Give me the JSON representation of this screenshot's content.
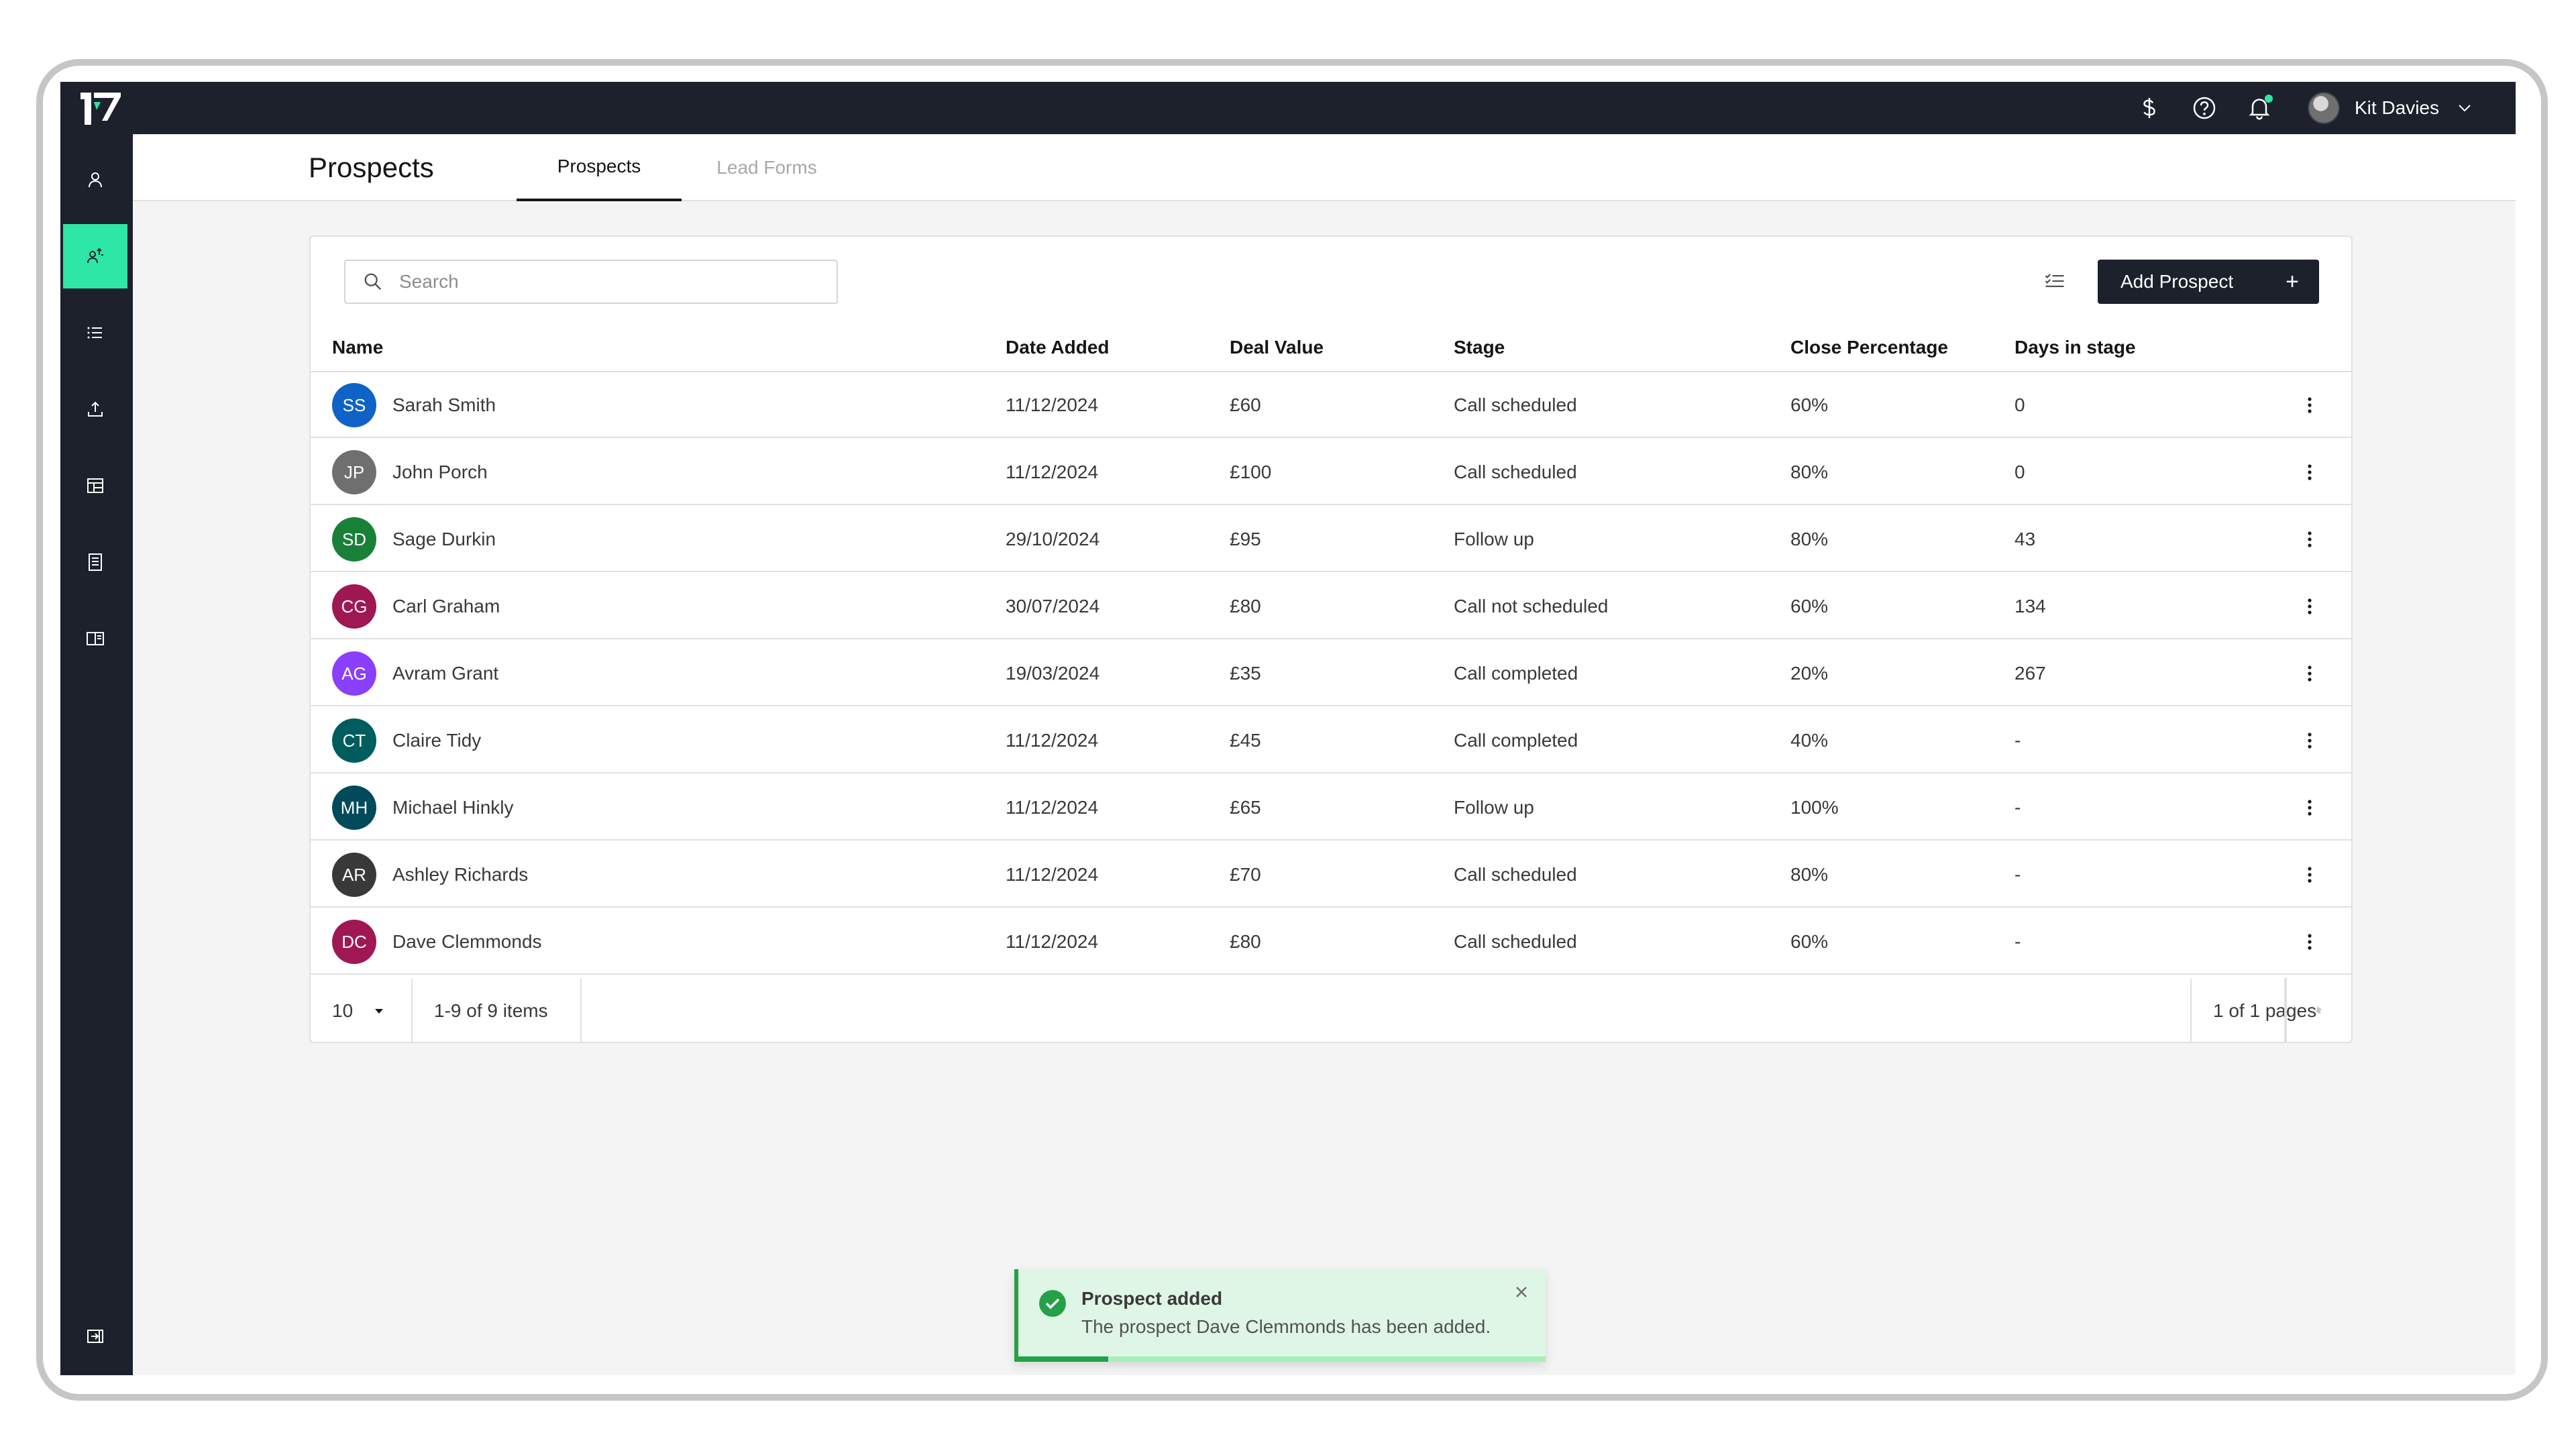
{
  "header": {
    "user_name": "Kit Davies",
    "icons": [
      "dollar-icon",
      "help-icon",
      "notification-bell-icon"
    ]
  },
  "sidebar": {
    "items": [
      {
        "icon": "user-icon",
        "active": false
      },
      {
        "icon": "prospects-icon",
        "active": true
      },
      {
        "icon": "list-icon",
        "active": false
      },
      {
        "icon": "upload-icon",
        "active": false
      },
      {
        "icon": "layout-icon",
        "active": false
      },
      {
        "icon": "document-icon",
        "active": false
      },
      {
        "icon": "book-icon",
        "active": false
      }
    ],
    "bottom_icon": "expand-icon"
  },
  "page": {
    "title": "Prospects",
    "tabs": [
      {
        "label": "Prospects",
        "active": true
      },
      {
        "label": "Lead Forms",
        "active": false
      }
    ]
  },
  "toolbar": {
    "search_placeholder": "Search",
    "add_button_label": "Add Prospect",
    "add_button_icon": "+"
  },
  "table": {
    "columns": [
      "Name",
      "Date Added",
      "Deal Value",
      "Stage",
      "Close Percentage",
      "Days in stage"
    ],
    "rows": [
      {
        "initials": "SS",
        "avatar_color": "#0f62c8",
        "name": "Sarah Smith",
        "date": "11/12/2024",
        "value": "£60",
        "stage": "Call scheduled",
        "close": "60%",
        "days": "0"
      },
      {
        "initials": "JP",
        "avatar_color": "#6f6f6f",
        "name": "John Porch",
        "date": "11/12/2024",
        "value": "£100",
        "stage": "Call scheduled",
        "close": "80%",
        "days": "0"
      },
      {
        "initials": "SD",
        "avatar_color": "#198038",
        "name": "Sage Durkin",
        "date": "29/10/2024",
        "value": "£95",
        "stage": "Follow up",
        "close": "80%",
        "days": "43"
      },
      {
        "initials": "CG",
        "avatar_color": "#9f1853",
        "name": "Carl Graham",
        "date": "30/07/2024",
        "value": "£80",
        "stage": "Call not scheduled",
        "close": "60%",
        "days": "134"
      },
      {
        "initials": "AG",
        "avatar_color": "#8a3ffc",
        "name": "Avram Grant",
        "date": "19/03/2024",
        "value": "£35",
        "stage": "Call completed",
        "close": "20%",
        "days": "267"
      },
      {
        "initials": "CT",
        "avatar_color": "#005d5d",
        "name": "Claire Tidy",
        "date": "11/12/2024",
        "value": "£45",
        "stage": "Call completed",
        "close": "40%",
        "days": "-"
      },
      {
        "initials": "MH",
        "avatar_color": "#004a5c",
        "name": "Michael Hinkly",
        "date": "11/12/2024",
        "value": "£65",
        "stage": "Follow up",
        "close": "100%",
        "days": "-"
      },
      {
        "initials": "AR",
        "avatar_color": "#393939",
        "name": "Ashley Richards",
        "date": "11/12/2024",
        "value": "£70",
        "stage": "Call scheduled",
        "close": "80%",
        "days": "-"
      },
      {
        "initials": "DC",
        "avatar_color": "#9f1853",
        "name": "Dave Clemmonds",
        "date": "11/12/2024",
        "value": "£80",
        "stage": "Call scheduled",
        "close": "60%",
        "days": "-"
      }
    ]
  },
  "pagination": {
    "page_size": "10",
    "items_range": "1-9 of 9 items",
    "pages": "1 of 1 pages"
  },
  "toast": {
    "title": "Prospect added",
    "message": "The prospect Dave Clemmonds has been added.",
    "progress_fraction": 0.17,
    "status_color": "#24a148"
  },
  "colors": {
    "accent": "#2ee6a6",
    "nav_dark": "#1c212c"
  }
}
